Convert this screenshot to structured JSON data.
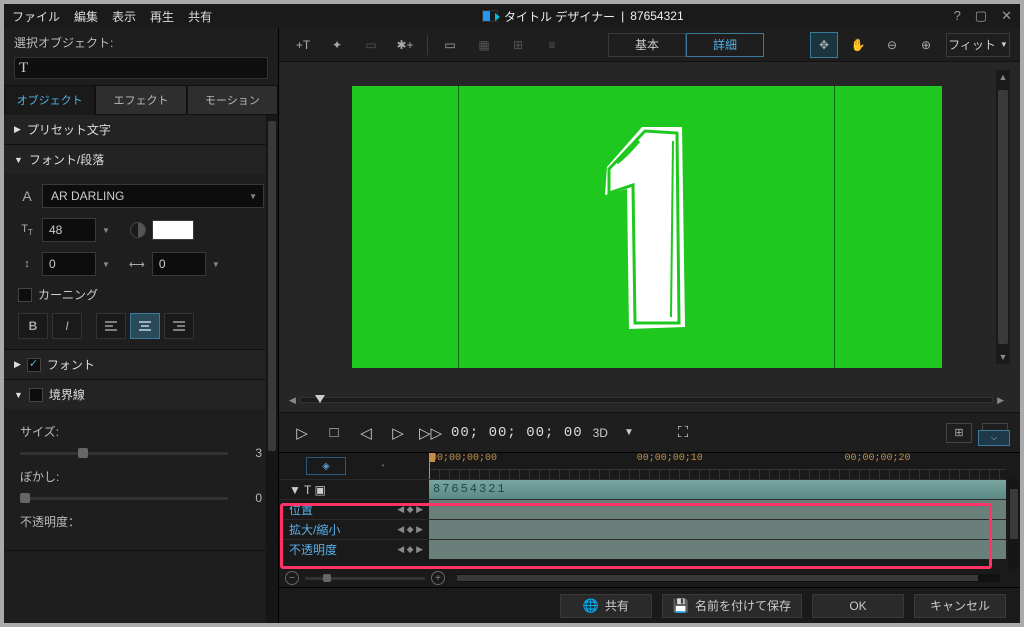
{
  "titlebar": {
    "menus": [
      "ファイル",
      "編集",
      "表示",
      "再生",
      "共有"
    ],
    "app_name": "タイトル デザイナー",
    "doc_name": "87654321"
  },
  "left": {
    "selection_label": "選択オブジェクト:",
    "tabs": [
      "オブジェクト",
      "エフェクト",
      "モーション"
    ],
    "sections": {
      "preset": "プリセット文字",
      "font_paragraph": "フォント/段落",
      "font": "フォント",
      "border": "境界線"
    },
    "font_family": "AR DARLING",
    "font_size": "48",
    "line_height": "0",
    "tracking": "0",
    "kerning_label": "カーニング",
    "size_label": "サイズ:",
    "size_value": "3",
    "blur_label": "ぼかし:",
    "blur_value": "0",
    "opacity_label": "不透明度："
  },
  "toolbar": {
    "mode_basic": "基本",
    "mode_advanced": "詳細",
    "fit_label": "フィット"
  },
  "playback": {
    "timecode": "00; 00; 00; 00",
    "three_d": "3D"
  },
  "timeline": {
    "labels": [
      "00;00;00;00",
      "00;00;00;10",
      "00;00;00;20"
    ],
    "clip_name": "87654321",
    "tracks": {
      "position": "位置",
      "scale": "拡大/縮小",
      "opacity": "不透明度"
    }
  },
  "footer": {
    "share": "共有",
    "save_as": "名前を付けて保存",
    "ok": "OK",
    "cancel": "キャンセル"
  }
}
